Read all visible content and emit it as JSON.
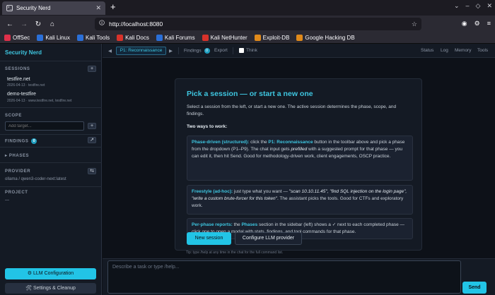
{
  "browser": {
    "tab_title": "Security Nerd",
    "tab_favicon": ">_",
    "url": "http://localhost:8080",
    "bookmarks": [
      {
        "label": "OffSec",
        "icon": "offsec-icon",
        "color": "#e0304a"
      },
      {
        "label": "Kali Linux",
        "icon": "kali-dragon-icon",
        "color": "#2a6fd8"
      },
      {
        "label": "Kali Tools",
        "icon": "kali-dragon-icon",
        "color": "#2a6fd8"
      },
      {
        "label": "Kali Docs",
        "icon": "kali-docs-icon",
        "color": "#d8322a"
      },
      {
        "label": "Kali Forums",
        "icon": "kali-dragon-icon",
        "color": "#2a6fd8"
      },
      {
        "label": "Kali NetHunter",
        "icon": "nethunter-icon",
        "color": "#d8322a"
      },
      {
        "label": "Exploit-DB",
        "icon": "exploit-db-icon",
        "color": "#e08a1a"
      },
      {
        "label": "Google Hacking DB",
        "icon": "ghdb-icon",
        "color": "#e08a1a"
      }
    ]
  },
  "sidebar": {
    "app_title": "Security Nerd",
    "sessions_header": "SESSIONS",
    "sessions": [
      {
        "name": "testfire.net",
        "meta": "2026-04-13 · testfire.net"
      },
      {
        "name": "demo-testfire",
        "meta": "2026-04-13 · www.testfire.net, testfire.net"
      }
    ],
    "scope_header": "SCOPE",
    "scope_placeholder": "Add target...",
    "findings_header": "FINDINGS",
    "findings_count": "0",
    "phases_header": "PHASES",
    "provider_header": "PROVIDER",
    "provider_value": "ollama / qwen3-coder-next:latest",
    "project_header": "PROJECT",
    "project_value": "—",
    "llm_config_label": "⚙ LLM Configuration",
    "settings_label": "🛠 Settings & Cleanup"
  },
  "toolbar": {
    "prev": "◀",
    "phase_label": "P1: Reconnaissance",
    "next": "▶",
    "findings_label": "Findings",
    "findings_count": "0",
    "export_label": "Export",
    "think_label": "Think",
    "right_items": [
      "Status",
      "Log",
      "Memory",
      "Tools"
    ]
  },
  "card": {
    "title": "Pick a session — or start a new one",
    "intro": "Select a session from the left, or start a new one. The active session determines the phase, scope, and findings.",
    "ways_title": "Two ways to work:",
    "ways": [
      {
        "key": "Phase-driven (structured):",
        "t1": " click the ",
        "k2": "P1: Reconnaissance",
        "t2": " button in the toolbar above and pick a phase from the dropdown (P1–P9). The chat input gets ",
        "em": "prefilled",
        "t3": " with a suggested prompt for that phase — you can edit it, then hit Send. Good for methodology-driven work, client engagements, OSCP practice."
      },
      {
        "key": "Freestyle (ad-hoc):",
        "t1": " just type what you want — ",
        "em": "\"scan 10.10.11.45\", \"find SQL injection on the login page\", \"write a custom brute-forcer for this token\"",
        "t2": ". The assistant picks the tools. Good for CTFs and exploratory work."
      },
      {
        "key": "Per-phase reports:",
        "t1": " the ",
        "k2": "Phases",
        "t2": " section in the sidebar (left) shows a ✓ next to each completed phase — click one to open a modal with stats, findings, and tool commands for that phase."
      }
    ],
    "new_session_label": "New session",
    "configure_label": "Configure LLM provider"
  },
  "tip": "Tip: type /help at any time in the chat for the full command list.",
  "composer": {
    "placeholder": "Describe a task or type /help...",
    "send_label": "Send"
  }
}
